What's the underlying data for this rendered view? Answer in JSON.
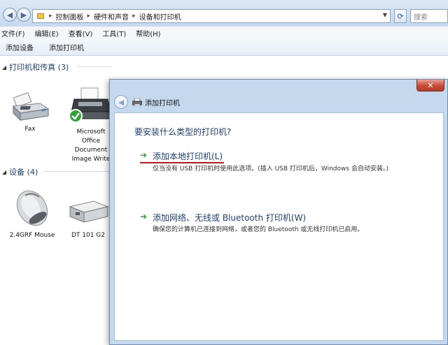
{
  "explorer": {
    "breadcrumbs": [
      "控制面板",
      "硬件和声音",
      "设备和打印机"
    ],
    "search_placeholder": "搜索",
    "menu": [
      "文件(F)",
      "编辑(E)",
      "查看(V)",
      "工具(T)",
      "帮助(H)"
    ],
    "commands": [
      "添加设备",
      "添加打印机"
    ],
    "groups": {
      "printers": {
        "title": "打印机和传真 (3)"
      },
      "devices": {
        "title": "设备 (4)"
      }
    },
    "printers": [
      {
        "label": "Fax"
      },
      {
        "label_lines": [
          "Microsoft",
          "Office",
          "Document",
          "Image Write"
        ]
      }
    ],
    "devices": [
      {
        "label": "2.4GRF Mouse"
      },
      {
        "label": "DT 101 G2"
      }
    ]
  },
  "dialog": {
    "title": "添加打印机",
    "question": "要安装什么类型的打印机?",
    "options": [
      {
        "title": "添加本地打印机(L)",
        "description": "仅当没有 USB 打印机时使用此选项。(插入 USB 打印机后，Windows 会自动安装。)"
      },
      {
        "title": "添加网络、无线或 Bluetooth 打印机(W)",
        "description": "确保您的计算机已连接到网络，或者您的 Bluetooth 或无线打印机已启用。"
      }
    ]
  },
  "colors": {
    "annotation_underline": "#c8161d",
    "link_blue": "#1e3f73",
    "arrow_green": "#2e9a2e"
  }
}
